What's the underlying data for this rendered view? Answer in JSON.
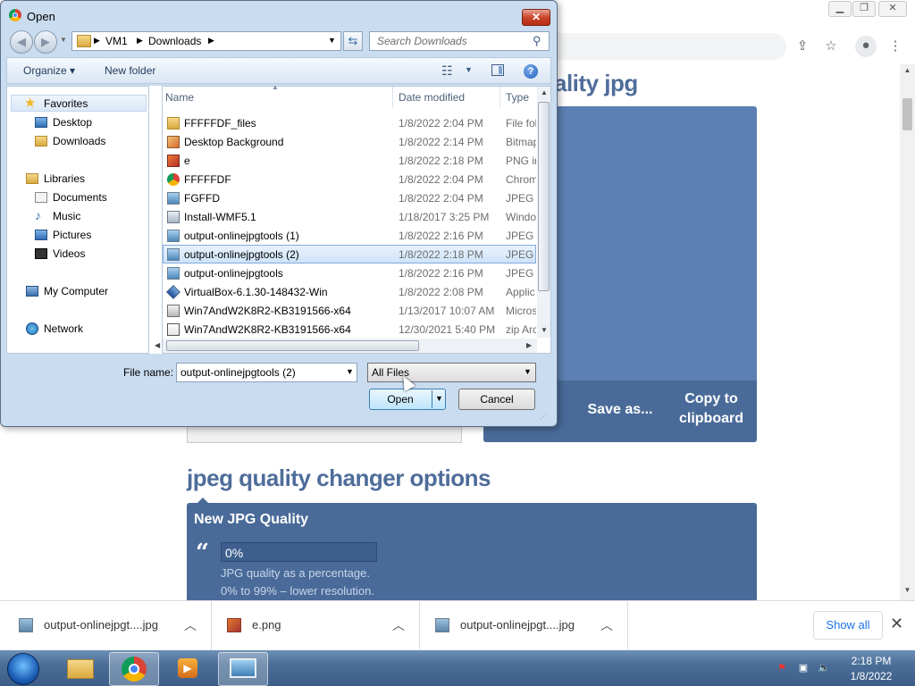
{
  "browser": {
    "window_controls": {
      "minimize": "▭",
      "restore": "❐",
      "close": "✕"
    },
    "toolbar_icons": [
      "share-icon",
      "star-icon",
      "profile-icon",
      "menu-icon"
    ],
    "page": {
      "partial_title": "ality jpg",
      "output_buttons": {
        "save_as": "Save as...",
        "copy_line1": "Copy to",
        "copy_line2": "clipboard"
      },
      "options_heading": "jpeg quality changer options",
      "options_title": "New JPG Quality",
      "quality_value": "0%",
      "quality_help1": "JPG quality as a percentage.",
      "quality_help2": "0% to 99% – lower resolution."
    }
  },
  "downloads": {
    "items": [
      {
        "name": "output-onlinejpgt....jpg",
        "icon": "jpg-file-icon"
      },
      {
        "name": "e.png",
        "icon": "png-file-icon"
      },
      {
        "name": "output-onlinejpgt....jpg",
        "icon": "jpg-file-icon"
      }
    ],
    "show_all": "Show all",
    "close": "✕"
  },
  "taskbar": {
    "time": "2:18 PM",
    "date": "1/8/2022",
    "pinned": [
      "explorer",
      "chrome",
      "media-player",
      "photo-viewer"
    ]
  },
  "dialog": {
    "title": "Open",
    "close": "✕",
    "address": {
      "segments": [
        "VM1",
        "Downloads"
      ]
    },
    "search_placeholder": "Search Downloads",
    "commands": {
      "organize": "Organize ▾",
      "new_folder": "New folder"
    },
    "nav": {
      "favorites": "Favorites",
      "desktop": "Desktop",
      "downloads": "Downloads",
      "libraries": "Libraries",
      "documents": "Documents",
      "music": "Music",
      "pictures": "Pictures",
      "videos": "Videos",
      "my_computer": "My Computer",
      "network": "Network"
    },
    "columns": {
      "name": "Name",
      "date": "Date modified",
      "type": "Type"
    },
    "files": [
      {
        "name": "FFFFFDF_files",
        "date": "1/8/2022 2:04 PM",
        "type": "File fol",
        "icon": "folder"
      },
      {
        "name": "Desktop Background",
        "date": "1/8/2022 2:14 PM",
        "type": "Bitmap",
        "icon": "bmp"
      },
      {
        "name": "e",
        "date": "1/8/2022 2:18 PM",
        "type": "PNG ir",
        "icon": "png"
      },
      {
        "name": "FFFFFDF",
        "date": "1/8/2022 2:04 PM",
        "type": "Chrom",
        "icon": "chrome"
      },
      {
        "name": "FGFFD",
        "date": "1/8/2022 2:04 PM",
        "type": "JPEG ir",
        "icon": "image"
      },
      {
        "name": "Install-WMF5.1",
        "date": "1/18/2017 3:25 PM",
        "type": "Windo",
        "icon": "exe"
      },
      {
        "name": "output-onlinejpgtools (1)",
        "date": "1/8/2022 2:16 PM",
        "type": "JPEG ir",
        "icon": "image"
      },
      {
        "name": "output-onlinejpgtools (2)",
        "date": "1/8/2022 2:18 PM",
        "type": "JPEG ir",
        "icon": "image",
        "selected": true
      },
      {
        "name": "output-onlinejpgtools",
        "date": "1/8/2022 2:16 PM",
        "type": "JPEG ir",
        "icon": "image"
      },
      {
        "name": "VirtualBox-6.1.30-148432-Win",
        "date": "1/8/2022 2:08 PM",
        "type": "Applic",
        "icon": "vbox"
      },
      {
        "name": "Win7AndW2K8R2-KB3191566-x64",
        "date": "1/13/2017 10:07 AM",
        "type": "Micros",
        "icon": "msu"
      },
      {
        "name": "Win7AndW2K8R2-KB3191566-x64",
        "date": "12/30/2021 5:40 PM",
        "type": "zip Arc",
        "icon": "zip"
      }
    ],
    "file_name_label": "File name:",
    "file_name_value": "output-onlinejpgtools (2)",
    "file_type_value": "All Files",
    "open_label": "Open",
    "cancel_label": "Cancel"
  }
}
